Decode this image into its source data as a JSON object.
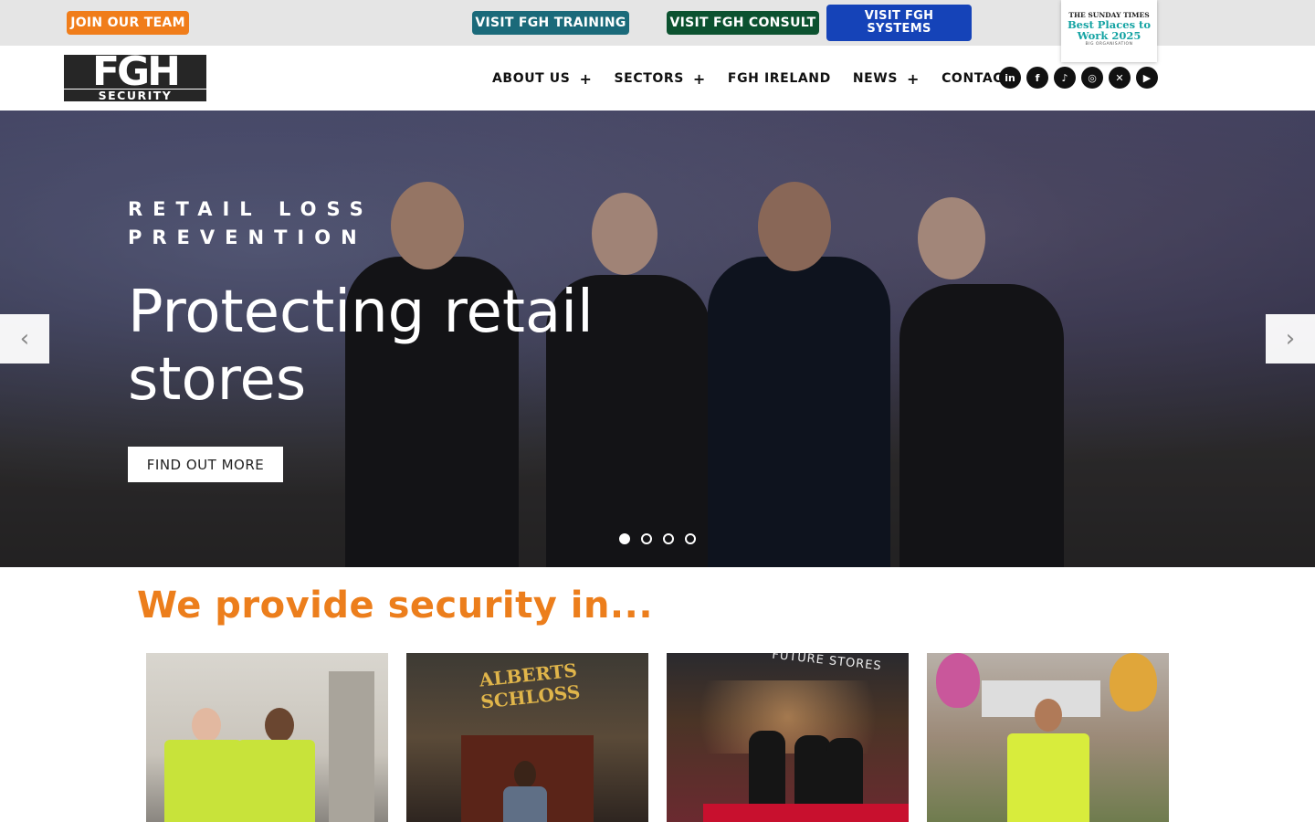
{
  "topbar": {
    "join_label": "JOIN OUR TEAM",
    "training_label": "VISIT FGH TRAINING",
    "consult_label": "VISIT FGH CONSULT",
    "systems_label": "VISIT FGH SYSTEMS",
    "award": {
      "pre": "",
      "publication": "THE SUNDAY TIMES",
      "title": "Best Places to Work 2025",
      "sub": "BIG ORGANISATION"
    }
  },
  "header": {
    "logo_top": "FGH",
    "logo_bottom": "SECURITY",
    "nav": [
      {
        "label": "ABOUT US",
        "plus": "+"
      },
      {
        "label": "SECTORS",
        "plus": "+"
      },
      {
        "label": "FGH IRELAND",
        "plus": ""
      },
      {
        "label": "NEWS",
        "plus": "+"
      },
      {
        "label": "CONTACT",
        "plus": ""
      }
    ],
    "social": [
      {
        "icon": "linkedin-icon",
        "glyph": "in"
      },
      {
        "icon": "facebook-icon",
        "glyph": "f"
      },
      {
        "icon": "tiktok-icon",
        "glyph": "♪"
      },
      {
        "icon": "instagram-icon",
        "glyph": "◎"
      },
      {
        "icon": "x-icon",
        "glyph": "✕"
      },
      {
        "icon": "youtube-icon",
        "glyph": "▶"
      }
    ]
  },
  "hero": {
    "eyebrow": "RETAIL LOSS PREVENTION",
    "headline": "Protecting retail stores",
    "cta_label": "FIND OUT MORE",
    "prev_glyph": "‹",
    "next_glyph": "›",
    "slide_count": 4,
    "active_slide": 1
  },
  "sectors": {
    "title": "We provide security in...",
    "cards": [
      {
        "name": "street-patrol"
      },
      {
        "name": "hospitality",
        "sign": "ALBERTS SCHLOSS"
      },
      {
        "name": "retail",
        "sign": "FUTURE STORES"
      },
      {
        "name": "events"
      }
    ]
  },
  "colors": {
    "accent_orange": "#ec7e1c",
    "training_teal": "#1b6a7a",
    "consult_green": "#0c5230",
    "systems_blue": "#1543b8"
  }
}
